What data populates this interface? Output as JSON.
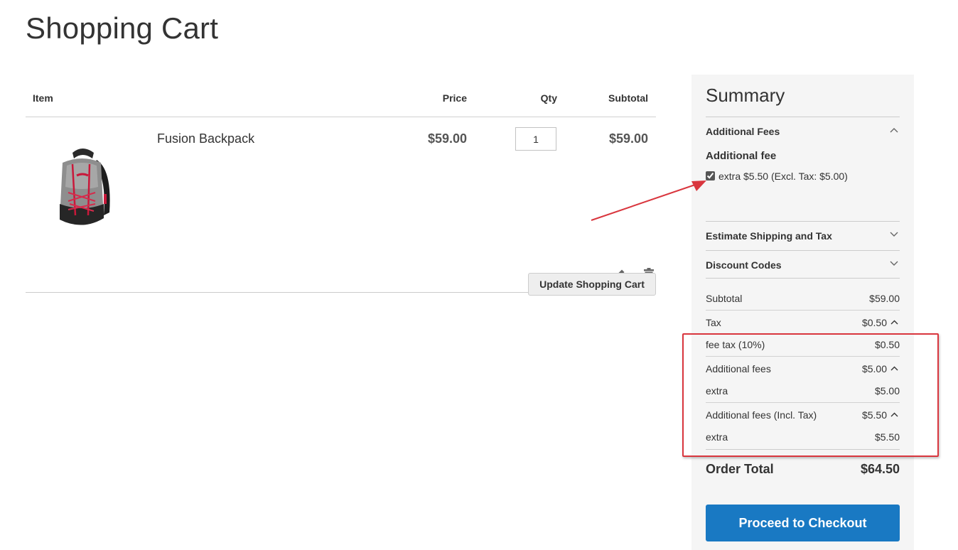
{
  "page": {
    "title": "Shopping Cart"
  },
  "cart": {
    "headers": {
      "item": "Item",
      "price": "Price",
      "qty": "Qty",
      "subtotal": "Subtotal"
    },
    "items": [
      {
        "name": "Fusion Backpack",
        "price": "$59.00",
        "qty": "1",
        "subtotal": "$59.00",
        "image_icon": "backpack-image"
      }
    ],
    "update_label": "Update Shopping Cart"
  },
  "summary": {
    "title": "Summary",
    "additional_fees_block": {
      "title": "Additional Fees",
      "subheading": "Additional fee",
      "option_label": "extra $5.50 (Excl. Tax: $5.00)",
      "option_checked": true
    },
    "shipping_block": {
      "title": "Estimate Shipping and Tax"
    },
    "discount_block": {
      "title": "Discount Codes"
    },
    "totals": [
      {
        "label": "Subtotal",
        "value": "$59.00"
      },
      {
        "label": "Tax",
        "value": "$0.50"
      },
      {
        "label": "fee tax (10%)",
        "value": "$0.50"
      },
      {
        "label": "Additional fees",
        "value": "$5.00"
      },
      {
        "label": "extra",
        "value": "$5.00"
      },
      {
        "label": "Additional fees (Incl. Tax)",
        "value": "$5.50"
      },
      {
        "label": "extra",
        "value": "$5.50"
      }
    ],
    "order_total": {
      "label": "Order Total",
      "value": "$64.50"
    },
    "checkout_label": "Proceed to Checkout"
  },
  "colors": {
    "primary_button": "#1979c3",
    "summary_background": "#f5f5f5",
    "annotation": "#d9363e"
  }
}
